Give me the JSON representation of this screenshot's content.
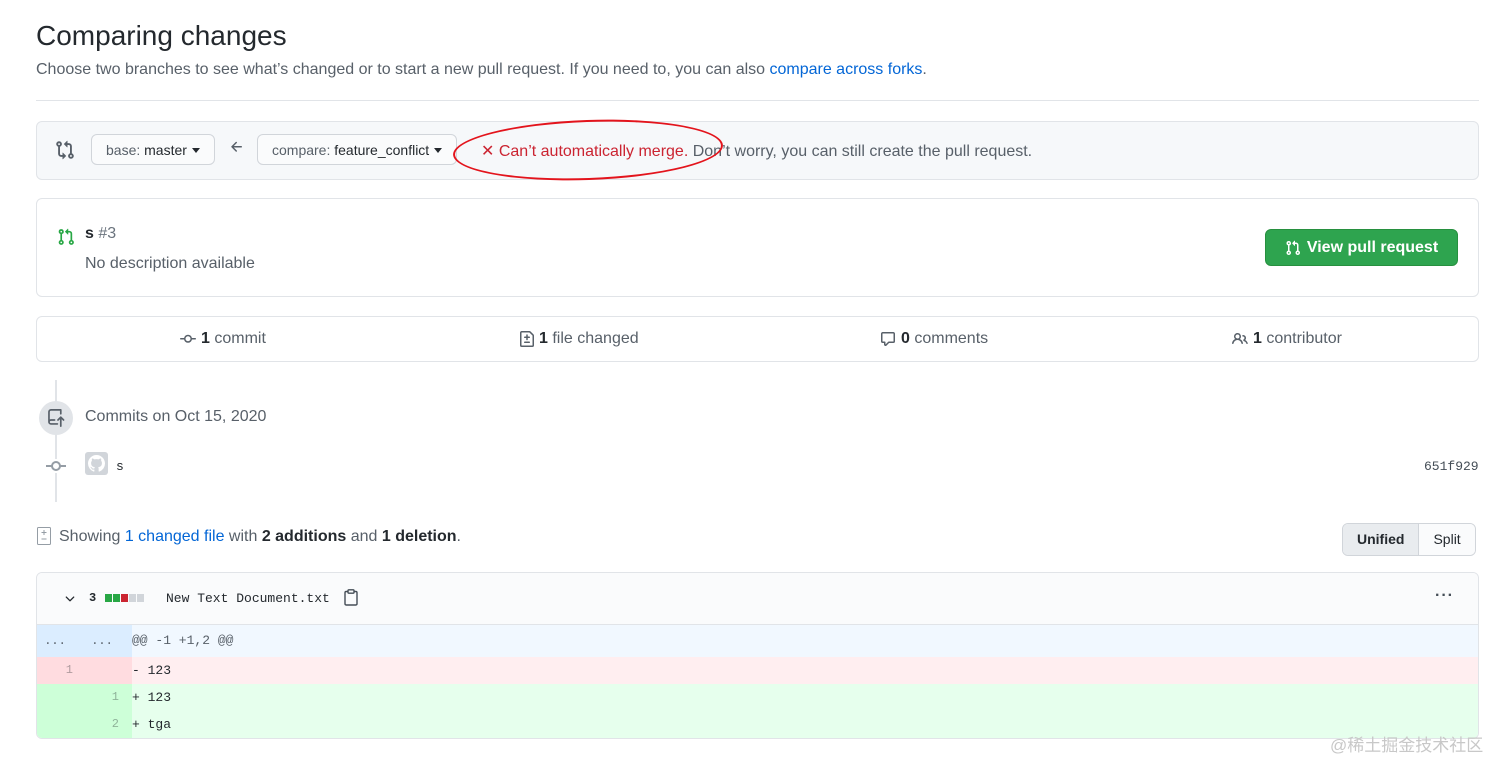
{
  "header": {
    "title": "Comparing changes",
    "subtitle": "Choose two branches to see what’s changed or to start a new pull request. If you need to, you can also ",
    "subtitle_link": "compare across forks",
    "subtitle_end": "."
  },
  "range": {
    "base_label": "base:",
    "base_value": "master",
    "compare_label": "compare:",
    "compare_value": "feature_conflict",
    "merge_status_bad": "✕ Can’t automatically merge.",
    "merge_status_rest": " Don’t worry, you can still create the pull request.",
    "status_color": "#cb2431"
  },
  "pull_request": {
    "title": "s",
    "number": "#3",
    "description": "No description available",
    "view_button": "View pull request",
    "button_color": "#2ea44f"
  },
  "stats": {
    "commits_count": "1",
    "commits_label": " commit",
    "files_count": "1",
    "files_label": " file changed",
    "comments_count": "0",
    "comments_label": " comments",
    "contributors_count": "1",
    "contributors_label": " contributor"
  },
  "commits": {
    "date_heading": "Commits on Oct 15, 2020",
    "items": [
      {
        "message": "s",
        "sha": "651f929"
      }
    ]
  },
  "files_summary": {
    "prefix": "Showing ",
    "changed_link": "1 changed file",
    "with": " with ",
    "additions": "2 additions",
    "and": " and ",
    "deletions": "1 deletion",
    "end": "."
  },
  "view_toggle": {
    "unified": "Unified",
    "split": "Split",
    "selected": "Unified"
  },
  "diff": {
    "change_count": "3",
    "file_name": "New Text Document.txt",
    "more_menu": "···",
    "hunk": {
      "left": "...",
      "right": "...",
      "text": "@@ -1 +1,2 @@"
    },
    "lines": [
      {
        "type": "del",
        "old": "1",
        "new": "",
        "text": "- 123"
      },
      {
        "type": "add",
        "old": "",
        "new": "1",
        "text": "+ 123"
      },
      {
        "type": "add",
        "old": "",
        "new": "2",
        "text": "+ tga"
      }
    ]
  },
  "watermark": "@稀土掘金技术社区"
}
